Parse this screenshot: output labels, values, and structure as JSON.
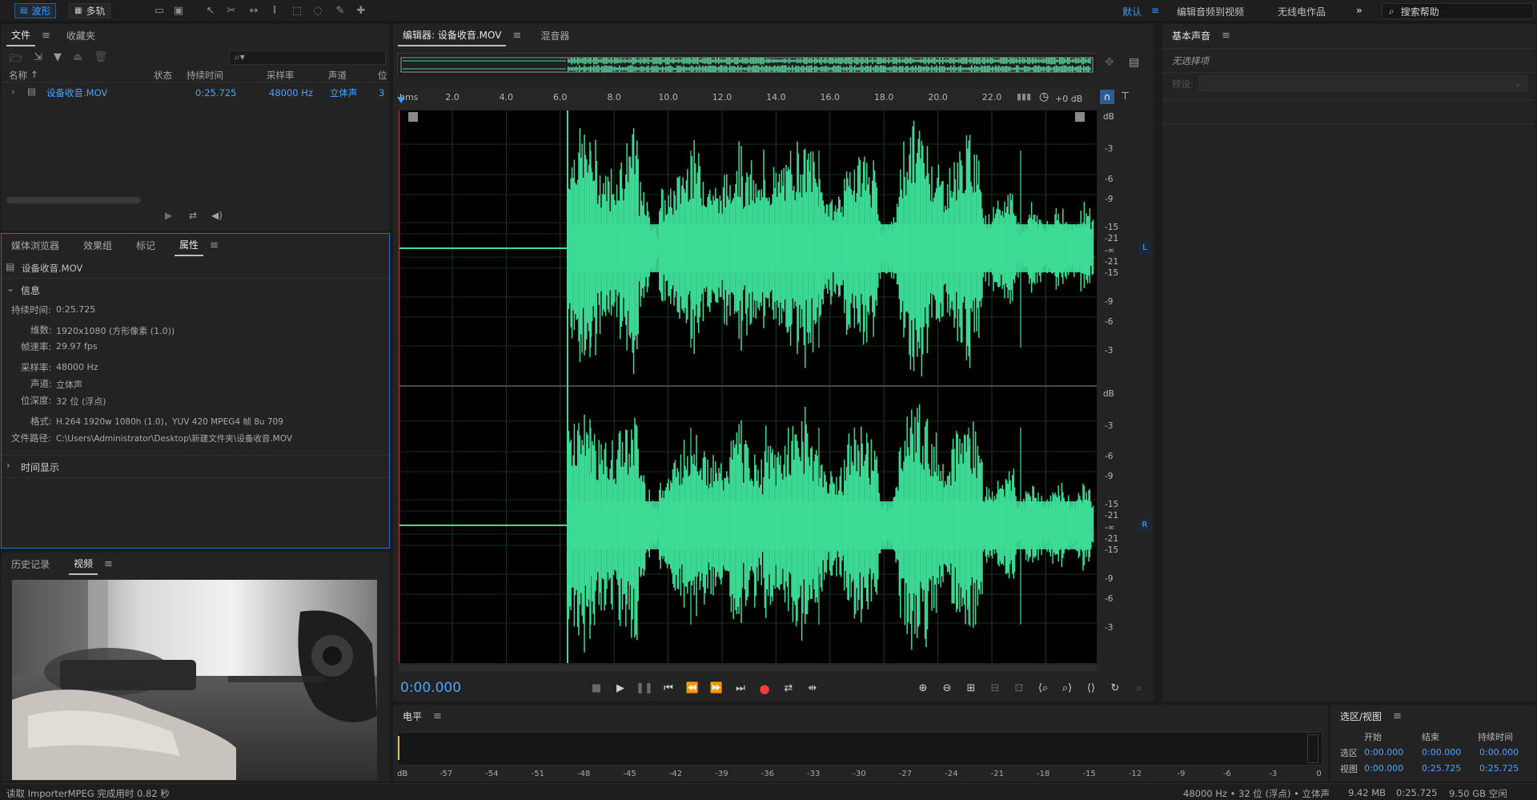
{
  "topbar": {
    "modes": [
      {
        "label": "波形",
        "active": true
      },
      {
        "label": "多轨",
        "active": false
      }
    ],
    "workspace": {
      "default_label": "默认",
      "items": [
        "编辑音频到视频",
        "无线电作品"
      ]
    },
    "search": {
      "label": "搜索帮助"
    }
  },
  "files_panel": {
    "tabs": [
      {
        "label": "文件",
        "active": true
      },
      {
        "label": "收藏夹",
        "active": false
      }
    ],
    "columns": [
      "名称",
      "状态",
      "持续时间",
      "采样率",
      "声道",
      "位"
    ],
    "rows": [
      {
        "name": "设备收音.MOV",
        "status": "",
        "duration": "0:25.725",
        "sample_rate": "48000 Hz",
        "channels": "立体声",
        "bits": "3"
      }
    ]
  },
  "props_panel": {
    "tabs": [
      {
        "label": "媒体浏览器",
        "active": false
      },
      {
        "label": "效果组",
        "active": false
      },
      {
        "label": "标记",
        "active": false
      },
      {
        "label": "属性",
        "active": true
      }
    ],
    "filename": "设备收音.MOV",
    "info_section": "信息",
    "rows": [
      {
        "label": "持续时间:",
        "value": "0:25.725"
      },
      {
        "label": "维数:",
        "value": "1920x1080 (方形像素 (1.0))"
      },
      {
        "label": "帧速率:",
        "value": "29.97 fps"
      },
      {
        "label": "采样率:",
        "value": "48000 Hz"
      },
      {
        "label": "声道:",
        "value": "立体声"
      },
      {
        "label": "位深度:",
        "value": "32 位 (浮点)"
      },
      {
        "label": "格式:",
        "value": "H.264 1920w 1080h (1.0)，YUV 420 MPEG4 帧 8u 709"
      },
      {
        "label": "文件路径:",
        "value": "C:\\Users\\Administrator\\Desktop\\新建文件夹\\设备收音.MOV"
      }
    ],
    "time_section": "时间显示"
  },
  "video_panel": {
    "tabs": [
      {
        "label": "历史记录",
        "active": false
      },
      {
        "label": "视频",
        "active": true
      }
    ]
  },
  "editor": {
    "tabs": [
      {
        "label": "编辑器: 设备收音.MOV",
        "active": true
      },
      {
        "label": "混音器",
        "active": false
      }
    ],
    "ruler_unit": "hms",
    "ruler_ticks": [
      "2.0",
      "4.0",
      "6.0",
      "8.0",
      "10.0",
      "12.0",
      "14.0",
      "16.0",
      "18.0",
      "20.0",
      "22.0"
    ],
    "gain": "+0 dB",
    "db_unit": "dB",
    "db_scale": [
      "-3",
      "-6",
      "-9",
      "-15",
      "-21",
      "-∞",
      "-21",
      "-15",
      "-9",
      "-6",
      "-3"
    ],
    "channels": [
      "L",
      "R"
    ],
    "time_display": "0:00.000",
    "waveform_color": "#3ddc97"
  },
  "meter": {
    "title": "电平",
    "unit": "dB",
    "scale": [
      "-57",
      "-54",
      "-51",
      "-48",
      "-45",
      "-42",
      "-39",
      "-36",
      "-33",
      "-30",
      "-27",
      "-24",
      "-21",
      "-18",
      "-15",
      "-12",
      "-9",
      "-6",
      "-3",
      "0"
    ]
  },
  "selection_view": {
    "title": "选区/视图",
    "headers": [
      "开始",
      "结束",
      "持续时间"
    ],
    "rows": [
      {
        "label": "选区",
        "start": "0:00.000",
        "end": "0:00.000",
        "duration": "0:00.000"
      },
      {
        "label": "视图",
        "start": "0:00.000",
        "end": "0:25.725",
        "duration": "0:25.725"
      }
    ]
  },
  "essential_sound": {
    "title": "基本声音",
    "no_selection": "无选择项",
    "preset_label": "预设:"
  },
  "statusbar": {
    "left": "读取 ImporterMPEG 完成用时 0.82 秒",
    "format": "48000 Hz • 32 位 (浮点) • 立体声",
    "size": "9.42 MB",
    "duration": "0:25.725",
    "free": "9.50 GB 空闲"
  },
  "colors": {
    "accent": "#3b9cff",
    "waveform": "#3ddc97",
    "background": "#232323"
  }
}
